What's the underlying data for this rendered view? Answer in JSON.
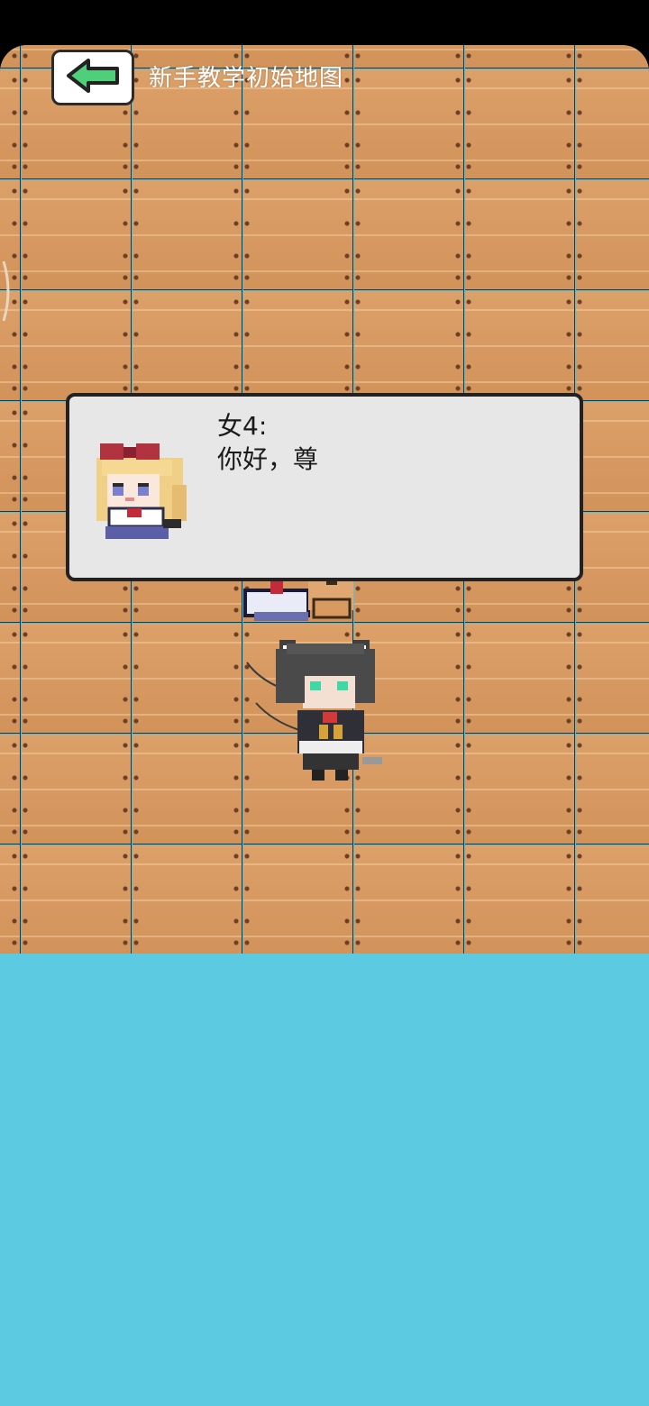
{
  "header": {
    "back_icon": "green-left-arrow-icon",
    "map_title": "新手教学初始地图"
  },
  "dialog": {
    "speaker": "女4:",
    "text": "你好，尊",
    "portrait": "blonde-girl-red-bow-portrait"
  },
  "map": {
    "floor": "wooden-plank-tiles",
    "background_color": "#5ccae0",
    "floor_color": "#d89b62"
  },
  "characters": [
    {
      "name": "npc-girl-4",
      "sprite": "blonde-girl-sprite"
    },
    {
      "name": "player",
      "sprite": "dark-haired-catgirl-sprite"
    }
  ]
}
